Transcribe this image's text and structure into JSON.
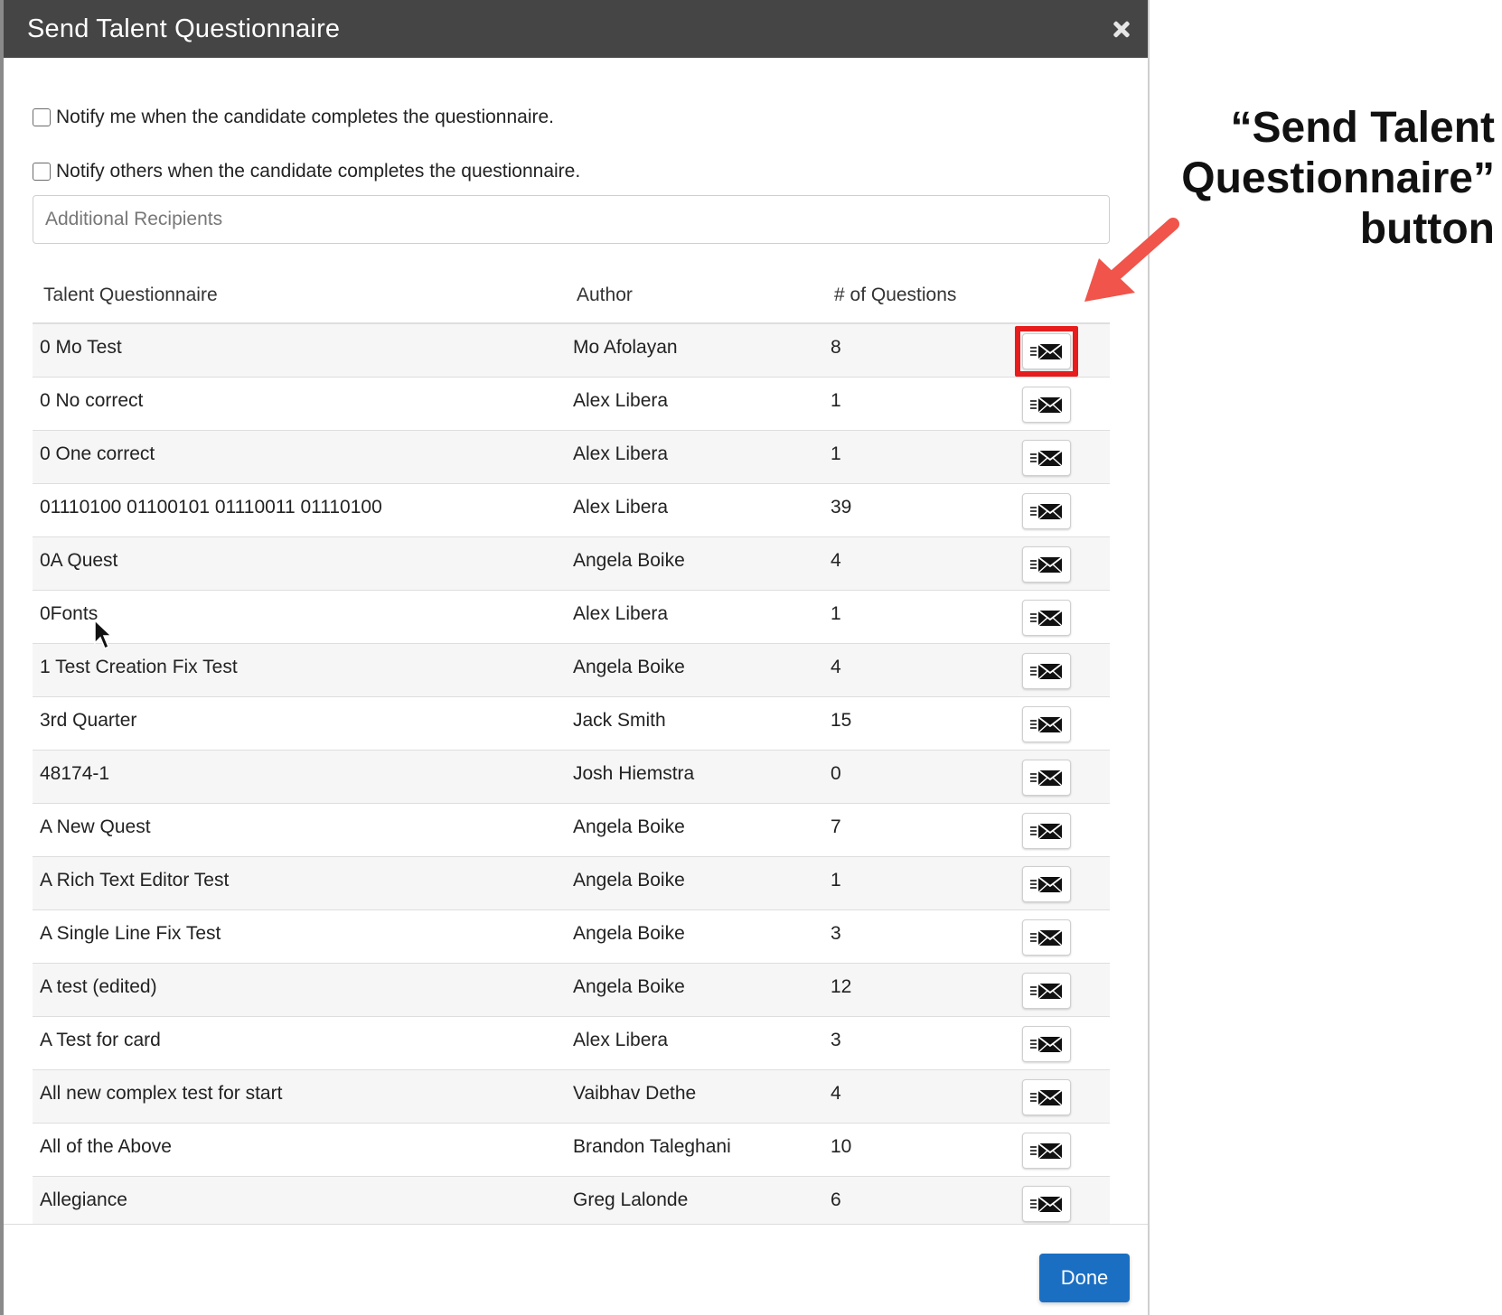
{
  "modal": {
    "title": "Send Talent Questionnaire",
    "notify_me_label": "Notify me when the candidate completes the questionnaire.",
    "notify_others_label": "Notify others when the candidate completes the questionnaire.",
    "recipients_placeholder": "Additional Recipients",
    "done_label": "Done"
  },
  "table": {
    "headers": [
      "Talent Questionnaire",
      "Author",
      "# of Questions"
    ],
    "rows": [
      {
        "name": "0 Mo Test",
        "author": "Mo Afolayan",
        "count": "8"
      },
      {
        "name": "0 No correct",
        "author": "Alex Libera",
        "count": "1"
      },
      {
        "name": "0 One correct",
        "author": "Alex Libera",
        "count": "1"
      },
      {
        "name": "01110100 01100101 01110011 01110100",
        "author": "Alex Libera",
        "count": "39"
      },
      {
        "name": "0A Quest",
        "author": "Angela Boike",
        "count": "4"
      },
      {
        "name": "0Fonts",
        "author": "Alex Libera",
        "count": "1"
      },
      {
        "name": "1 Test Creation Fix Test",
        "author": "Angela Boike",
        "count": "4"
      },
      {
        "name": "3rd Quarter",
        "author": "Jack Smith",
        "count": "15"
      },
      {
        "name": "48174-1",
        "author": "Josh Hiemstra",
        "count": "0"
      },
      {
        "name": "A New Quest",
        "author": "Angela Boike",
        "count": "7"
      },
      {
        "name": "A Rich Text Editor Test",
        "author": "Angela Boike",
        "count": "1"
      },
      {
        "name": "A Single Line Fix Test",
        "author": "Angela Boike",
        "count": "3"
      },
      {
        "name": "A test (edited)",
        "author": "Angela Boike",
        "count": "12"
      },
      {
        "name": "A Test for card",
        "author": "Alex Libera",
        "count": "3"
      },
      {
        "name": "All new complex test for start",
        "author": "Vaibhav Dethe",
        "count": "4"
      },
      {
        "name": "All of the Above",
        "author": "Brandon Taleghani",
        "count": "10"
      },
      {
        "name": "Allegiance",
        "author": "Greg Lalonde",
        "count": "6"
      }
    ],
    "action_icon": "send-envelope-icon"
  },
  "annotation": {
    "callout_text": "“Send Talent Questionnaire” button",
    "highlight_color": "#e81c1c",
    "arrow_color": "#f0544a"
  },
  "colors": {
    "header_bg": "#454545",
    "primary": "#1b6fc2"
  }
}
